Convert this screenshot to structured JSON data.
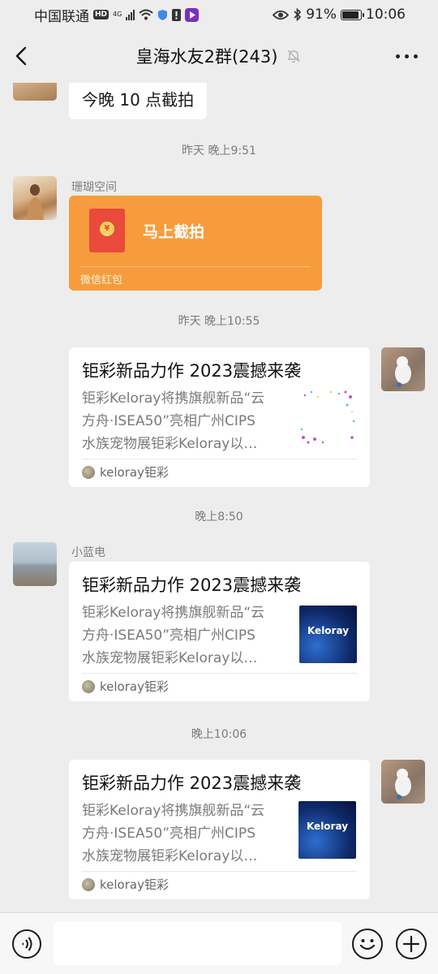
{
  "status_bar": {
    "carrier": "中国联通",
    "hd": "HD",
    "network": "4G",
    "battery_percent": "91%",
    "battery_level": 0.91,
    "time": "10:06"
  },
  "header": {
    "title": "皇海水友2群(243)"
  },
  "messages": {
    "m0": {
      "text": "今晚 10 点截拍"
    },
    "t1": "昨天 晚上9:51",
    "m1": {
      "sender": "珊瑚空间",
      "red_packet_text": "马上截拍",
      "red_packet_label": "微信红包",
      "coin": "¥"
    },
    "t2": "昨天 晚上10:55",
    "m2": {
      "title": "钜彩新品力作 2023震撼来袭",
      "desc_lines": [
        "钜彩Keloray将携旗舰新品“云",
        "方舟·ISEA50”亮相广州CIPS",
        "水族宠物展钜彩Keloray以…"
      ],
      "source": "keloray钜彩"
    },
    "t3": "晚上8:50",
    "m3": {
      "sender": "小蓝电",
      "title": "钜彩新品力作 2023震撼来袭",
      "desc_lines": [
        "钜彩Keloray将携旗舰新品“云",
        "方舟·ISEA50”亮相广州CIPS",
        "水族宠物展钜彩Keloray以…"
      ],
      "source": "keloray钜彩",
      "thumb_text": "Keloray"
    },
    "t4": "晚上10:06",
    "m4": {
      "title": "钜彩新品力作 2023震撼来袭",
      "desc_lines": [
        "钜彩Keloray将携旗舰新品“云",
        "方舟·ISEA50”亮相广州CIPS",
        "水族宠物展钜彩Keloray以…"
      ],
      "source": "keloray钜彩",
      "thumb_text": "Keloray"
    }
  },
  "input_bar": {
    "placeholder": ""
  }
}
